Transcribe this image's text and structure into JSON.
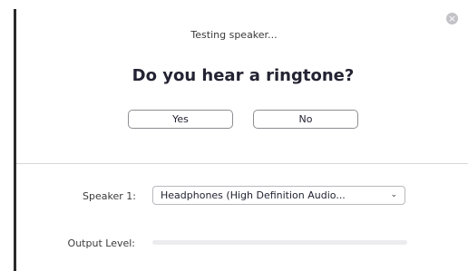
{
  "dialog": {
    "status_text": "Testing speaker...",
    "question": "Do you hear a ringtone?",
    "yes_label": "Yes",
    "no_label": "No",
    "close_icon": "close-icon"
  },
  "speaker": {
    "label": "Speaker 1:",
    "selected": "Headphones (High Definition Audio...",
    "dropdown_icon": "chevron-down-icon"
  },
  "output_level": {
    "label": "Output Level:",
    "level": 0
  },
  "colors": {
    "accent": "#2d8cff",
    "text": "#232333",
    "border": "#8e8e93"
  }
}
